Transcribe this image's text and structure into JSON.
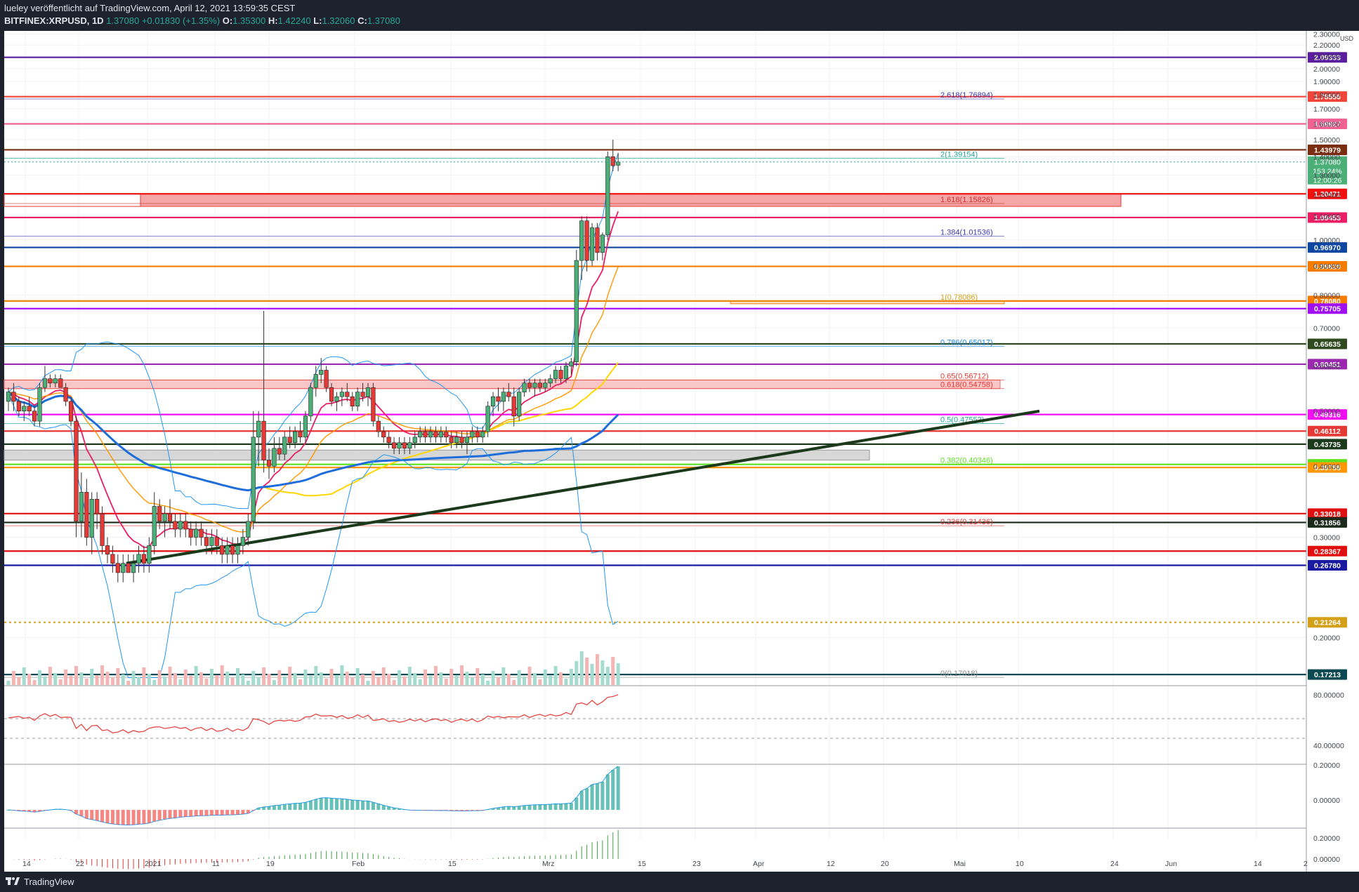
{
  "header": {
    "published": "lueley veröffentlicht auf TradingView.com, April 12, 2021 13:59:35 CEST",
    "symbol": "BITFINEX:XRPUSD, 1D",
    "last": "1.37080",
    "change": "+0.01830 (+1.35%)",
    "open_label": "O:",
    "open": "1.35300",
    "high_label": "H:",
    "high": "1.42240",
    "low_label": "L:",
    "low": "1.32060",
    "close_label": "C:",
    "close": "1.37080"
  },
  "footer": {
    "brand": "TradingView"
  },
  "colors": {
    "bg": "#ffffff",
    "frame": "#1e222d",
    "up": "#26a69a",
    "down": "#ef5350"
  },
  "chart_data": {
    "type": "candlestick",
    "currency": "USD",
    "y_scale": "log",
    "ylim": [
      0.165,
      2.33
    ],
    "price_ticks": [
      "2.30000",
      "2.20000",
      "2.10000",
      "2.00000",
      "1.90000",
      "1.80000",
      "1.70000",
      "1.60000",
      "1.50000",
      "1.40000",
      "1.30000",
      "1.20000",
      "1.10000",
      "1.00000",
      "0.90000",
      "0.80000",
      "0.70000",
      "0.60000",
      "0.50000",
      "0.40000",
      "0.30000",
      "0.20000"
    ],
    "x_ticks": [
      "14",
      "22",
      "2021",
      "11",
      "19",
      "Feb",
      "15",
      "Mrz",
      "15",
      "23",
      "Apr",
      "12",
      "20",
      "Mai",
      "10",
      "24",
      "Jun",
      "14",
      "2"
    ],
    "levels": [
      {
        "value": 2.09333,
        "label": "2.09333",
        "color": "#5b1e9c"
      },
      {
        "value": 1.78556,
        "label": "1.78556",
        "color": "#f0453a"
      },
      {
        "value": 1.59927,
        "label": "1.59927",
        "color": "#f06292"
      },
      {
        "value": 1.43979,
        "label": "1.43979",
        "color": "#7b2d10"
      },
      {
        "value": 1.20471,
        "label": "1.20471",
        "color": "#f01010"
      },
      {
        "value": 1.09453,
        "label": "1.09453",
        "color": "#e91e63"
      },
      {
        "value": 0.9697,
        "label": "0.96970",
        "color": "#0d47a1"
      },
      {
        "value": 0.8982,
        "label": "0.89820",
        "color": "#f57c00"
      },
      {
        "value": 0.7808,
        "label": "0.78080",
        "color": "#f57c00"
      },
      {
        "value": 0.75705,
        "label": "0.75705",
        "color": "#a010f0"
      },
      {
        "value": 0.65635,
        "label": "0.65635",
        "color": "#2e4a1e"
      },
      {
        "value": 0.60451,
        "label": "0.60451",
        "color": "#9c27b0"
      },
      {
        "value": 0.49316,
        "label": "0.49316",
        "color": "#f010f0"
      },
      {
        "value": 0.46112,
        "label": "0.46112",
        "color": "#e53935"
      },
      {
        "value": 0.43735,
        "label": "0.43735",
        "color": "#1b3a1b"
      },
      {
        "value": 0.40299,
        "label": "0.40299",
        "color": "#5ee021"
      },
      {
        "value": 0.39788,
        "label": "0.39788",
        "color": "#ff9800"
      },
      {
        "value": 0.33018,
        "label": "0.33018",
        "color": "#e01010"
      },
      {
        "value": 0.31856,
        "label": "0.31856",
        "color": "#1b2a1b"
      },
      {
        "value": 0.28367,
        "label": "0.28367",
        "color": "#e01010"
      },
      {
        "value": 0.2678,
        "label": "0.26780",
        "color": "#1a1aa0"
      },
      {
        "value": 0.21264,
        "label": "0.21264",
        "color": "#d4a017"
      },
      {
        "value": 0.17213,
        "label": "0.17213",
        "color": "#0b4a52"
      }
    ],
    "fib": [
      {
        "label": "2.618(1.76894)",
        "value": 1.76894,
        "color": "#3a3ab0"
      },
      {
        "label": "2(1.39154)",
        "value": 1.39154,
        "color": "#26a69a"
      },
      {
        "label": "1.618(1.15826)",
        "value": 1.15826,
        "color": "#d32f2f"
      },
      {
        "label": "1.384(1.01536)",
        "value": 1.01536,
        "color": "#3a3ab0"
      },
      {
        "label": "1(0.78086)",
        "value": 0.78086,
        "color": "#d4a017"
      },
      {
        "label": "0.786(0.65017)",
        "value": 0.65017,
        "color": "#1e88e5"
      },
      {
        "label": "0.65(0.56712)",
        "value": 0.56712,
        "color": "#e53935"
      },
      {
        "label": "0.618(0.54758)",
        "value": 0.54758,
        "color": "#e53935"
      },
      {
        "label": "0.5(0.47552)",
        "value": 0.47552,
        "color": "#26a69a"
      },
      {
        "label": "0.382(0.40346)",
        "value": 0.40346,
        "color": "#5ee021"
      },
      {
        "label": "0.236(0.31436)",
        "value": 0.31436,
        "color": "#e53935"
      },
      {
        "label": "0(0.17018)",
        "value": 0.17018,
        "color": "#888888"
      }
    ],
    "last_price": {
      "value": 1.3708,
      "label": "1.37080",
      "change": "153.24%",
      "countdown": "12:00:26"
    },
    "candles": [
      [
        0.52,
        0.55,
        0.5,
        0.54
      ],
      [
        0.54,
        0.56,
        0.5,
        0.52
      ],
      [
        0.52,
        0.53,
        0.49,
        0.5
      ],
      [
        0.5,
        0.52,
        0.48,
        0.51
      ],
      [
        0.51,
        0.53,
        0.49,
        0.5
      ],
      [
        0.5,
        0.51,
        0.47,
        0.48
      ],
      [
        0.48,
        0.56,
        0.47,
        0.55
      ],
      [
        0.55,
        0.6,
        0.54,
        0.57
      ],
      [
        0.57,
        0.58,
        0.55,
        0.56
      ],
      [
        0.56,
        0.58,
        0.55,
        0.57
      ],
      [
        0.57,
        0.58,
        0.55,
        0.55
      ],
      [
        0.55,
        0.56,
        0.51,
        0.52
      ],
      [
        0.52,
        0.53,
        0.47,
        0.48
      ],
      [
        0.48,
        0.49,
        0.3,
        0.32
      ],
      [
        0.32,
        0.39,
        0.3,
        0.36
      ],
      [
        0.36,
        0.38,
        0.29,
        0.3
      ],
      [
        0.3,
        0.36,
        0.28,
        0.35
      ],
      [
        0.35,
        0.36,
        0.31,
        0.33
      ],
      [
        0.33,
        0.34,
        0.28,
        0.29
      ],
      [
        0.29,
        0.3,
        0.27,
        0.28
      ],
      [
        0.28,
        0.29,
        0.26,
        0.27
      ],
      [
        0.27,
        0.28,
        0.25,
        0.26
      ],
      [
        0.26,
        0.28,
        0.25,
        0.27
      ],
      [
        0.27,
        0.28,
        0.26,
        0.26
      ],
      [
        0.26,
        0.28,
        0.25,
        0.27
      ],
      [
        0.27,
        0.29,
        0.26,
        0.28
      ],
      [
        0.28,
        0.29,
        0.26,
        0.27
      ],
      [
        0.27,
        0.3,
        0.26,
        0.29
      ],
      [
        0.29,
        0.36,
        0.28,
        0.34
      ],
      [
        0.34,
        0.35,
        0.31,
        0.32
      ],
      [
        0.32,
        0.34,
        0.3,
        0.33
      ],
      [
        0.33,
        0.35,
        0.31,
        0.32
      ],
      [
        0.32,
        0.33,
        0.3,
        0.31
      ],
      [
        0.31,
        0.33,
        0.3,
        0.32
      ],
      [
        0.32,
        0.33,
        0.3,
        0.31
      ],
      [
        0.31,
        0.32,
        0.29,
        0.3
      ],
      [
        0.3,
        0.32,
        0.29,
        0.31
      ],
      [
        0.31,
        0.32,
        0.29,
        0.3
      ],
      [
        0.3,
        0.31,
        0.28,
        0.29
      ],
      [
        0.29,
        0.31,
        0.28,
        0.3
      ],
      [
        0.3,
        0.31,
        0.28,
        0.29
      ],
      [
        0.29,
        0.3,
        0.27,
        0.28
      ],
      [
        0.28,
        0.3,
        0.27,
        0.29
      ],
      [
        0.29,
        0.3,
        0.27,
        0.28
      ],
      [
        0.28,
        0.3,
        0.27,
        0.29
      ],
      [
        0.29,
        0.31,
        0.28,
        0.3
      ],
      [
        0.3,
        0.33,
        0.29,
        0.32
      ],
      [
        0.32,
        0.5,
        0.31,
        0.45
      ],
      [
        0.45,
        0.5,
        0.4,
        0.48
      ],
      [
        0.48,
        0.75,
        0.39,
        0.41
      ],
      [
        0.41,
        0.43,
        0.38,
        0.4
      ],
      [
        0.4,
        0.45,
        0.39,
        0.43
      ],
      [
        0.43,
        0.45,
        0.41,
        0.42
      ],
      [
        0.42,
        0.46,
        0.41,
        0.45
      ],
      [
        0.45,
        0.47,
        0.43,
        0.44
      ],
      [
        0.44,
        0.47,
        0.43,
        0.46
      ],
      [
        0.46,
        0.48,
        0.44,
        0.45
      ],
      [
        0.45,
        0.5,
        0.44,
        0.49
      ],
      [
        0.49,
        0.56,
        0.48,
        0.55
      ],
      [
        0.55,
        0.6,
        0.53,
        0.58
      ],
      [
        0.58,
        0.62,
        0.56,
        0.59
      ],
      [
        0.59,
        0.6,
        0.54,
        0.55
      ],
      [
        0.55,
        0.56,
        0.51,
        0.52
      ],
      [
        0.52,
        0.54,
        0.5,
        0.53
      ],
      [
        0.53,
        0.55,
        0.51,
        0.54
      ],
      [
        0.54,
        0.56,
        0.52,
        0.53
      ],
      [
        0.53,
        0.54,
        0.5,
        0.51
      ],
      [
        0.51,
        0.55,
        0.5,
        0.54
      ],
      [
        0.54,
        0.56,
        0.52,
        0.53
      ],
      [
        0.53,
        0.56,
        0.51,
        0.55
      ],
      [
        0.55,
        0.56,
        0.47,
        0.48
      ],
      [
        0.48,
        0.49,
        0.45,
        0.46
      ],
      [
        0.46,
        0.47,
        0.44,
        0.45
      ],
      [
        0.45,
        0.46,
        0.43,
        0.44
      ],
      [
        0.44,
        0.45,
        0.42,
        0.43
      ],
      [
        0.43,
        0.45,
        0.42,
        0.44
      ],
      [
        0.44,
        0.45,
        0.42,
        0.43
      ],
      [
        0.43,
        0.45,
        0.42,
        0.44
      ],
      [
        0.44,
        0.46,
        0.43,
        0.45
      ],
      [
        0.45,
        0.47,
        0.44,
        0.46
      ],
      [
        0.46,
        0.47,
        0.44,
        0.45
      ],
      [
        0.45,
        0.47,
        0.44,
        0.46
      ],
      [
        0.46,
        0.47,
        0.44,
        0.45
      ],
      [
        0.45,
        0.47,
        0.44,
        0.46
      ],
      [
        0.46,
        0.47,
        0.44,
        0.45
      ],
      [
        0.45,
        0.46,
        0.43,
        0.44
      ],
      [
        0.44,
        0.46,
        0.43,
        0.45
      ],
      [
        0.45,
        0.46,
        0.43,
        0.44
      ],
      [
        0.44,
        0.46,
        0.42,
        0.45
      ],
      [
        0.45,
        0.47,
        0.44,
        0.46
      ],
      [
        0.46,
        0.47,
        0.44,
        0.45
      ],
      [
        0.45,
        0.47,
        0.44,
        0.46
      ],
      [
        0.46,
        0.52,
        0.45,
        0.51
      ],
      [
        0.51,
        0.54,
        0.49,
        0.53
      ],
      [
        0.53,
        0.55,
        0.5,
        0.52
      ],
      [
        0.52,
        0.55,
        0.5,
        0.54
      ],
      [
        0.54,
        0.56,
        0.52,
        0.53
      ],
      [
        0.53,
        0.55,
        0.47,
        0.49
      ],
      [
        0.49,
        0.55,
        0.48,
        0.54
      ],
      [
        0.54,
        0.57,
        0.53,
        0.56
      ],
      [
        0.56,
        0.57,
        0.54,
        0.55
      ],
      [
        0.55,
        0.57,
        0.53,
        0.56
      ],
      [
        0.56,
        0.57,
        0.54,
        0.55
      ],
      [
        0.55,
        0.57,
        0.54,
        0.56
      ],
      [
        0.56,
        0.58,
        0.55,
        0.57
      ],
      [
        0.57,
        0.6,
        0.56,
        0.59
      ],
      [
        0.59,
        0.6,
        0.56,
        0.57
      ],
      [
        0.57,
        0.61,
        0.56,
        0.6
      ],
      [
        0.6,
        0.62,
        0.58,
        0.61
      ],
      [
        0.61,
        0.96,
        0.6,
        0.92
      ],
      [
        0.92,
        1.1,
        0.85,
        1.08
      ],
      [
        1.08,
        1.1,
        0.88,
        0.92
      ],
      [
        0.92,
        1.07,
        0.9,
        1.05
      ],
      [
        1.05,
        1.07,
        0.92,
        0.95
      ],
      [
        0.95,
        1.03,
        0.92,
        1.02
      ],
      [
        1.02,
        1.43,
        1.0,
        1.4
      ],
      [
        1.4,
        1.5,
        1.32,
        1.35
      ],
      [
        1.353,
        1.4224,
        1.3206,
        1.3708
      ]
    ],
    "start_date": "2020-12-09",
    "indicators": {
      "rsi_levels": [
        "80.00000",
        "40.00000"
      ],
      "macd_levels": [
        "0.20000",
        "0.00000"
      ],
      "osc_levels": [
        "0.20000",
        "0.00000"
      ]
    }
  }
}
